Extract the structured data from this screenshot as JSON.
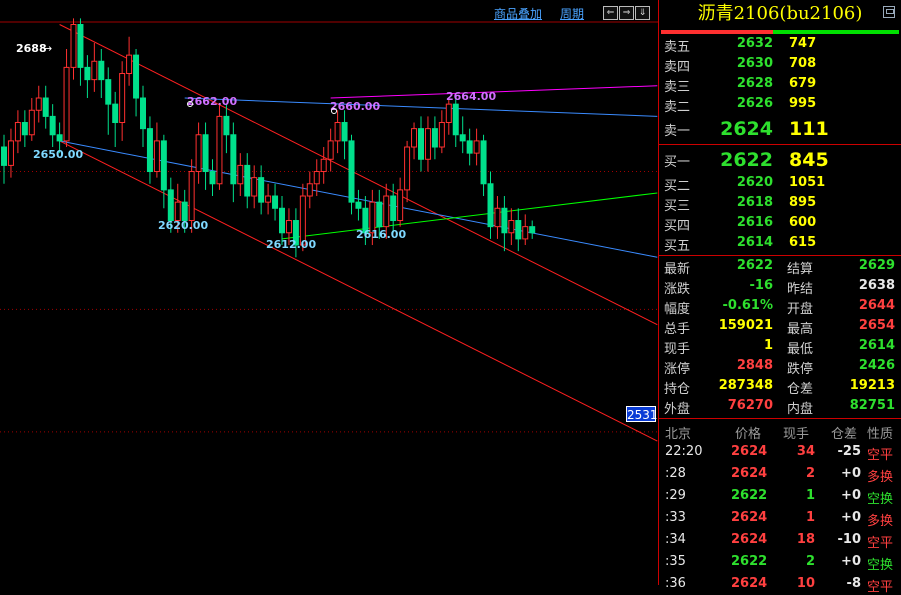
{
  "toolbar": {
    "overlay_label": "商品叠加",
    "period_label": "周期",
    "nav_buttons": [
      "⇐",
      "⇒",
      "⇓"
    ]
  },
  "chart_data": {
    "type": "candlestick",
    "price_axis_label": "2531",
    "candles": [
      [
        2648,
        2642,
        2652,
        2636
      ],
      [
        2642,
        2650,
        2654,
        2638
      ],
      [
        2650,
        2656,
        2660,
        2646
      ],
      [
        2656,
        2652,
        2660,
        2648
      ],
      [
        2652,
        2660,
        2664,
        2650
      ],
      [
        2660,
        2664,
        2668,
        2656
      ],
      [
        2664,
        2658,
        2668,
        2654
      ],
      [
        2658,
        2652,
        2662,
        2648
      ],
      [
        2652,
        2650,
        2656,
        2646
      ],
      [
        2650,
        2674,
        2680,
        2648
      ],
      [
        2674,
        2688,
        2690,
        2670
      ],
      [
        2688,
        2674,
        2690,
        2668
      ],
      [
        2674,
        2670,
        2678,
        2664
      ],
      [
        2670,
        2676,
        2682,
        2666
      ],
      [
        2676,
        2670,
        2680,
        2664
      ],
      [
        2670,
        2662,
        2674,
        2652
      ],
      [
        2662,
        2656,
        2666,
        2648
      ],
      [
        2656,
        2672,
        2676,
        2650
      ],
      [
        2672,
        2678,
        2684,
        2668
      ],
      [
        2678,
        2664,
        2680,
        2658
      ],
      [
        2664,
        2654,
        2668,
        2648
      ],
      [
        2654,
        2640,
        2658,
        2636
      ],
      [
        2640,
        2650,
        2656,
        2638
      ],
      [
        2650,
        2634,
        2652,
        2628
      ],
      [
        2634,
        2624,
        2638,
        2620
      ],
      [
        2624,
        2630,
        2636,
        2620
      ],
      [
        2630,
        2624,
        2634,
        2620
      ],
      [
        2624,
        2640,
        2644,
        2620
      ],
      [
        2640,
        2652,
        2656,
        2636
      ],
      [
        2652,
        2640,
        2656,
        2634
      ],
      [
        2640,
        2636,
        2644,
        2632
      ],
      [
        2636,
        2658,
        2662,
        2634
      ],
      [
        2658,
        2652,
        2662,
        2646
      ],
      [
        2652,
        2636,
        2656,
        2630
      ],
      [
        2636,
        2642,
        2646,
        2632
      ],
      [
        2642,
        2632,
        2646,
        2628
      ],
      [
        2632,
        2638,
        2642,
        2628
      ],
      [
        2638,
        2630,
        2642,
        2626
      ],
      [
        2630,
        2632,
        2636,
        2626
      ],
      [
        2632,
        2628,
        2636,
        2624
      ],
      [
        2628,
        2620,
        2632,
        2616
      ],
      [
        2620,
        2624,
        2628,
        2616
      ],
      [
        2624,
        2616,
        2628,
        2612
      ],
      [
        2616,
        2632,
        2636,
        2614
      ],
      [
        2632,
        2636,
        2640,
        2628
      ],
      [
        2636,
        2640,
        2644,
        2632
      ],
      [
        2640,
        2644,
        2648,
        2636
      ],
      [
        2644,
        2650,
        2654,
        2640
      ],
      [
        2650,
        2656,
        2660,
        2646
      ],
      [
        2656,
        2650,
        2660,
        2644
      ],
      [
        2650,
        2630,
        2652,
        2626
      ],
      [
        2630,
        2628,
        2634,
        2624
      ],
      [
        2628,
        2620,
        2632,
        2616
      ],
      [
        2620,
        2630,
        2634,
        2616
      ],
      [
        2630,
        2622,
        2634,
        2618
      ],
      [
        2622,
        2632,
        2636,
        2618
      ],
      [
        2632,
        2624,
        2636,
        2620
      ],
      [
        2624,
        2634,
        2638,
        2622
      ],
      [
        2634,
        2648,
        2650,
        2630
      ],
      [
        2648,
        2654,
        2656,
        2644
      ],
      [
        2654,
        2644,
        2658,
        2640
      ],
      [
        2644,
        2654,
        2658,
        2640
      ],
      [
        2654,
        2648,
        2658,
        2644
      ],
      [
        2648,
        2656,
        2660,
        2646
      ],
      [
        2656,
        2662,
        2664,
        2652
      ],
      [
        2662,
        2652,
        2664,
        2648
      ],
      [
        2652,
        2650,
        2658,
        2646
      ],
      [
        2650,
        2646,
        2654,
        2642
      ],
      [
        2646,
        2650,
        2654,
        2642
      ],
      [
        2650,
        2636,
        2652,
        2632
      ],
      [
        2636,
        2622,
        2640,
        2618
      ],
      [
        2622,
        2628,
        2632,
        2618
      ],
      [
        2628,
        2620,
        2632,
        2614
      ],
      [
        2620,
        2624,
        2628,
        2616
      ],
      [
        2624,
        2618,
        2628,
        2614
      ],
      [
        2618,
        2622,
        2626,
        2616
      ],
      [
        2622,
        2620,
        2624,
        2618
      ]
    ],
    "annotations": [
      {
        "text": "2688",
        "target": "high"
      },
      {
        "text": "2650.00",
        "target": "low"
      },
      {
        "text": "2662.00",
        "target": "high"
      },
      {
        "text": "2660.00",
        "target": "high"
      },
      {
        "text": "2664.00",
        "target": "high"
      },
      {
        "text": "2620.00",
        "target": "low"
      },
      {
        "text": "2612.00",
        "target": "low"
      },
      {
        "text": "2616.00",
        "target": "low"
      }
    ],
    "price_range": [
      2505,
      2696
    ],
    "colors": {
      "up": "#ff3030",
      "down": "#00e08c",
      "channel": "#ff2020",
      "support": "#00ff00",
      "resistance": "#ff00ff",
      "trend_blue": "#3a8bff",
      "grid": "#a00000"
    }
  },
  "quote": {
    "title": "沥青2106(bu2106)",
    "ask_bid_ratio": 0.47,
    "asks": [
      {
        "label": "卖五",
        "price": "2632",
        "vol": "747"
      },
      {
        "label": "卖四",
        "price": "2630",
        "vol": "708"
      },
      {
        "label": "卖三",
        "price": "2628",
        "vol": "679"
      },
      {
        "label": "卖二",
        "price": "2626",
        "vol": "995"
      }
    ],
    "ask1": {
      "label": "卖一",
      "price": "2624",
      "vol": "111"
    },
    "bid1": {
      "label": "买一",
      "price": "2622",
      "vol": "845"
    },
    "bids": [
      {
        "label": "买二",
        "price": "2620",
        "vol": "1051"
      },
      {
        "label": "买三",
        "price": "2618",
        "vol": "895"
      },
      {
        "label": "买四",
        "price": "2616",
        "vol": "600"
      },
      {
        "label": "买五",
        "price": "2614",
        "vol": "615"
      }
    ],
    "stats": [
      {
        "l1": "最新",
        "v1": "2622",
        "c1": "g",
        "l2": "结算",
        "v2": "2629",
        "c2": "g"
      },
      {
        "l1": "涨跌",
        "v1": "-16",
        "c1": "g",
        "l2": "昨结",
        "v2": "2638",
        "c2": "w"
      },
      {
        "l1": "幅度",
        "v1": "-0.61%",
        "c1": "g",
        "l2": "开盘",
        "v2": "2644",
        "c2": "r"
      },
      {
        "l1": "总手",
        "v1": "159021",
        "c1": "y",
        "l2": "最高",
        "v2": "2654",
        "c2": "r"
      },
      {
        "l1": "现手",
        "v1": "1",
        "c1": "y",
        "l2": "最低",
        "v2": "2614",
        "c2": "g"
      },
      {
        "l1": "涨停",
        "v1": "2848",
        "c1": "r",
        "l2": "跌停",
        "v2": "2426",
        "c2": "g"
      },
      {
        "l1": "持仓",
        "v1": "287348",
        "c1": "y",
        "l2": "仓差",
        "v2": "19213",
        "c2": "y"
      },
      {
        "l1": "外盘",
        "v1": "76270",
        "c1": "r",
        "l2": "内盘",
        "v2": "82751",
        "c2": "g"
      }
    ],
    "ticks_header": [
      "北京",
      "价格",
      "现手",
      "仓差",
      "性质"
    ],
    "ticks": [
      {
        "time": "22:20",
        "price": "2624",
        "vol": "34",
        "chg": "-25",
        "nature": "空平",
        "vc": "r",
        "nc": "r"
      },
      {
        "time": ":28",
        "price": "2624",
        "vol": "2",
        "chg": "+0",
        "nature": "多换",
        "vc": "r",
        "nc": "r"
      },
      {
        "time": ":29",
        "price": "2622",
        "vol": "1",
        "chg": "+0",
        "nature": "空换",
        "vc": "g",
        "nc": "g"
      },
      {
        "time": ":33",
        "price": "2624",
        "vol": "1",
        "chg": "+0",
        "nature": "多换",
        "vc": "r",
        "nc": "r"
      },
      {
        "time": ":34",
        "price": "2624",
        "vol": "18",
        "chg": "-10",
        "nature": "空平",
        "vc": "r",
        "nc": "r"
      },
      {
        "time": ":35",
        "price": "2622",
        "vol": "2",
        "chg": "+0",
        "nature": "空换",
        "vc": "g",
        "nc": "g"
      },
      {
        "time": ":36",
        "price": "2624",
        "vol": "10",
        "chg": "-8",
        "nature": "空平",
        "vc": "r",
        "nc": "r"
      }
    ]
  }
}
